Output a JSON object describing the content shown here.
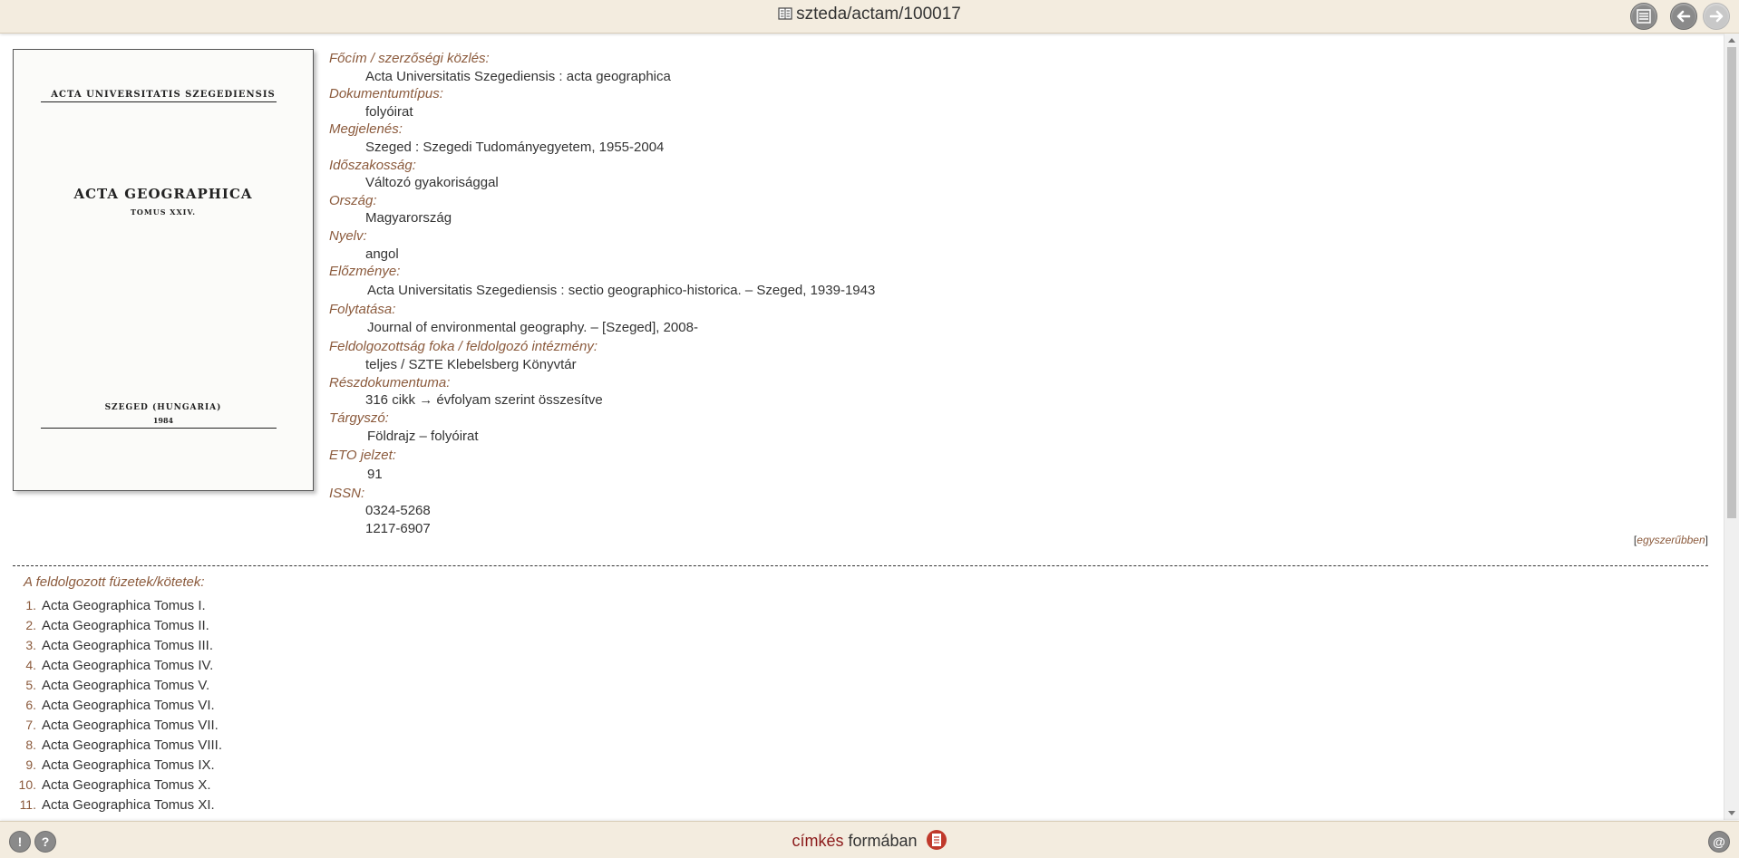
{
  "header": {
    "title": "szteda/actam/100017",
    "icons": {
      "doc": "document-icon",
      "list": "list-icon",
      "back": "back-arrow-icon",
      "forward": "forward-arrow-icon"
    }
  },
  "cover": {
    "university": "ACTA UNIVERSITATIS SZEGEDIENSIS",
    "title": "ACTA GEOGRAPHICA",
    "tomus": "TOMUS XXIV.",
    "place": "SZEGED (HUNGARIA)",
    "year": "1984"
  },
  "fields": [
    {
      "label": "Főcím / szerzőségi közlés:",
      "values": [
        "Acta Universitatis Szegediensis : acta geographica"
      ]
    },
    {
      "label": "Dokumentumtípus:",
      "values": [
        "folyóirat"
      ]
    },
    {
      "label": "Megjelenés:",
      "values": [
        "Szeged : Szegedi Tudományegyetem, 1955-2004"
      ]
    },
    {
      "label": "Időszakosság:",
      "values": [
        "Változó gyakorisággal"
      ]
    },
    {
      "label": "Ország:",
      "values": [
        "Magyarország"
      ]
    },
    {
      "label": "Nyelv:",
      "values": [
        "angol"
      ]
    },
    {
      "label": "Előzménye:",
      "values": [
        "Acta Universitatis Szegediensis : sectio geographico-historica. – Szeged, 1939-1943"
      ]
    },
    {
      "label": "Folytatása:",
      "values": [
        "Journal of environmental geography. – [Szeged], 2008-"
      ]
    },
    {
      "label": "Feldolgozottság foka / feldolgozó intézmény:",
      "values": [
        "teljes / SZTE Klebelsberg Könyvtár"
      ]
    },
    {
      "label": "Részdokumentuma:",
      "values": [
        "316 cikk → évfolyam szerint összesítve"
      ]
    },
    {
      "label": "Tárgyszó:",
      "values": [
        "Földrajz – folyóirat"
      ]
    },
    {
      "label": "ETO jelzet:",
      "values": [
        "91"
      ]
    },
    {
      "label": "ISSN:",
      "values": [
        "0324-5268",
        "1217-6907"
      ]
    }
  ],
  "simpler": {
    "open": "[",
    "label": "egyszerűbben",
    "close": "]"
  },
  "volumes": {
    "heading": "A feldolgozott füzetek/kötetek:",
    "items": [
      {
        "num": "1.",
        "label": "Acta Geographica Tomus I."
      },
      {
        "num": "2.",
        "label": "Acta Geographica Tomus II."
      },
      {
        "num": "3.",
        "label": "Acta Geographica Tomus III."
      },
      {
        "num": "4.",
        "label": "Acta Geographica Tomus IV."
      },
      {
        "num": "5.",
        "label": "Acta Geographica Tomus V."
      },
      {
        "num": "6.",
        "label": "Acta Geographica Tomus VI."
      },
      {
        "num": "7.",
        "label": "Acta Geographica Tomus VII."
      },
      {
        "num": "8.",
        "label": "Acta Geographica Tomus VIII."
      },
      {
        "num": "9.",
        "label": "Acta Geographica Tomus IX."
      },
      {
        "num": "10.",
        "label": "Acta Geographica Tomus X."
      },
      {
        "num": "11.",
        "label": "Acta Geographica Tomus XI."
      }
    ]
  },
  "footer": {
    "format_word1": "címkés",
    "format_word2": "formában",
    "info_label": "!",
    "help_label": "?",
    "contact_label": "@",
    "icons": {
      "pdf": "pdf-icon"
    }
  },
  "colors": {
    "accent": "#8b5a3c",
    "bar": "#f3ecdf",
    "pdf": "#c0392b"
  }
}
